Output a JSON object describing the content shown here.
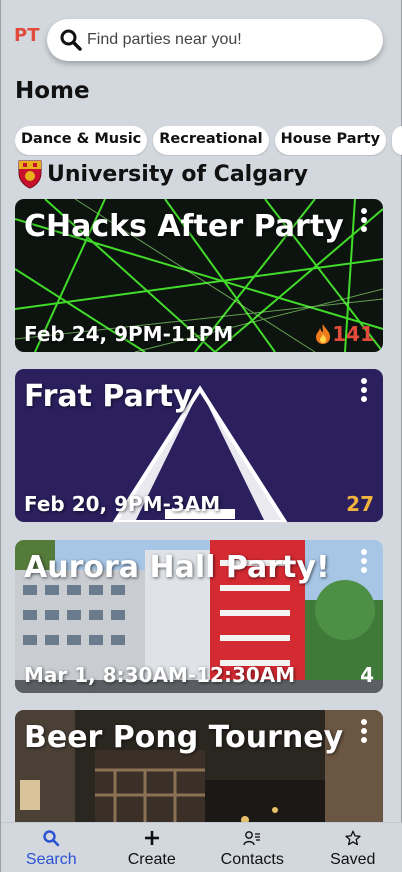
{
  "app": {
    "logo_text": "PT",
    "brand_color": "#e24a3b"
  },
  "search": {
    "placeholder": "Find parties near you!",
    "icon": "search-icon"
  },
  "page": {
    "title": "Home"
  },
  "categories": [
    {
      "label": "Dance & Music"
    },
    {
      "label": "Recreational"
    },
    {
      "label": "House Party"
    },
    {
      "label": ""
    }
  ],
  "university": {
    "name": "University of Calgary",
    "icon": "crest-icon"
  },
  "events": [
    {
      "title": "CHacks After Party",
      "date": "Feb 24, 9PM-11PM",
      "count": "141",
      "count_icon": "fire-icon",
      "count_color": "#e24a3b"
    },
    {
      "title": "Frat Party",
      "date": "Feb 20, 9PM-3AM",
      "count": "27",
      "count_color": "#f2b33d"
    },
    {
      "title": "Aurora Hall Party!",
      "date": "Mar 1, 8:30AM-12:30AM",
      "count": "4",
      "count_color": "#ffffff"
    },
    {
      "title": "Beer Pong Tourney",
      "date": "",
      "count": ""
    }
  ],
  "nav": [
    {
      "label": "Search",
      "icon": "search-icon",
      "active": true
    },
    {
      "label": "Create",
      "icon": "plus-icon"
    },
    {
      "label": "Contacts",
      "icon": "contacts-icon"
    },
    {
      "label": "Saved",
      "icon": "star-icon"
    }
  ],
  "colors": {
    "background": "#d3d8de",
    "active_nav": "#2a52d3",
    "frat_card": "#2b1f5e"
  }
}
